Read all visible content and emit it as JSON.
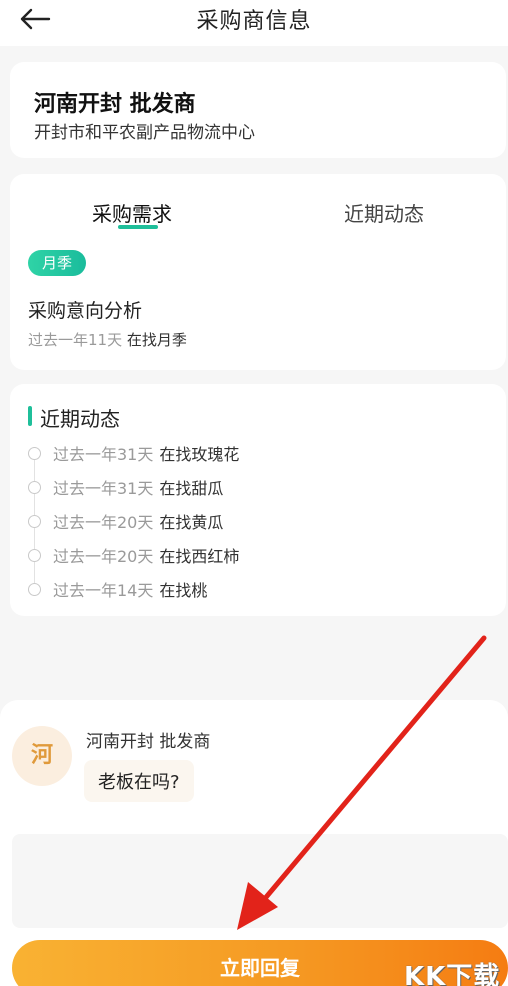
{
  "header": {
    "title": "采购商信息"
  },
  "supplier": {
    "name": "河南开封 批发商",
    "location": "开封市和平农副产品物流中心"
  },
  "tabs": [
    {
      "label": "采购需求"
    },
    {
      "label": "近期动态"
    }
  ],
  "demand": {
    "badge": "月季",
    "section_title": "采购意向分析",
    "time": "过去一年11天",
    "action": "在找月季"
  },
  "activity": {
    "title": "近期动态",
    "items": [
      {
        "time": "过去一年31天",
        "action": "在找玫瑰花"
      },
      {
        "time": "过去一年31天",
        "action": "在找甜瓜"
      },
      {
        "time": "过去一年20天",
        "action": "在找黄瓜"
      },
      {
        "time": "过去一年20天",
        "action": "在找西红柿"
      },
      {
        "time": "过去一年14天",
        "action": "在找桃"
      }
    ]
  },
  "message": {
    "avatar_char": "河",
    "sender": "河南开封 批发商",
    "text": "老板在吗?"
  },
  "reply_button": "立即回复",
  "watermark": "KK下载",
  "colors": {
    "accent_green": "#1fbf9a",
    "button_orange": "#f59a23",
    "annotation_red": "#e2231a"
  }
}
